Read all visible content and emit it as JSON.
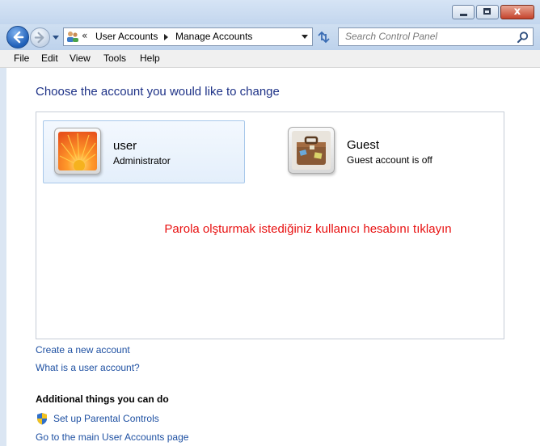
{
  "window": {
    "caption_close": "x"
  },
  "address": {
    "chevron": "«",
    "crumbs": [
      "User Accounts",
      "Manage Accounts"
    ]
  },
  "search": {
    "placeholder": "Search Control Panel"
  },
  "menu": {
    "items": [
      "File",
      "Edit",
      "View",
      "Tools",
      "Help"
    ]
  },
  "main": {
    "title": "Choose the account you would like to change",
    "accounts": [
      {
        "name": "user",
        "type": "Administrator",
        "icon": "flower-avatar-icon",
        "selected": true
      },
      {
        "name": "Guest",
        "type": "Guest account is off",
        "icon": "suitcase-avatar-icon",
        "selected": false
      }
    ],
    "instruction": "Parola olşturmak istediğiniz kullanıcı hesabını tıklayın",
    "links": [
      "Create a new account",
      "What is a user account?"
    ],
    "additional_heading": "Additional things you can do",
    "additional_links": [
      "Set up Parental Controls",
      "Go to the main User Accounts page"
    ]
  },
  "colors": {
    "title": "#1e3287",
    "link": "#1e50a2",
    "instruction": "#e81010",
    "selection_border": "#a8c8ea"
  }
}
